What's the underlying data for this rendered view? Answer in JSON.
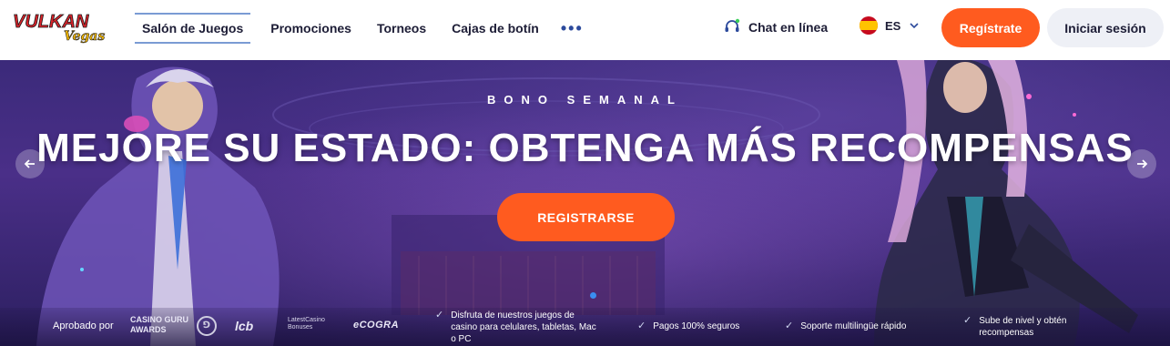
{
  "brand": {
    "logo_text_top": "VULKAN",
    "logo_text_bottom": "Vegas"
  },
  "nav": {
    "items": [
      {
        "label": "Salón de Juegos"
      },
      {
        "label": "Promociones"
      },
      {
        "label": "Torneos"
      },
      {
        "label": "Cajas de botín"
      }
    ],
    "more_label": "•••"
  },
  "header": {
    "chat_label": "Chat en línea",
    "language": "ES",
    "register_label": "Regístrate",
    "login_label": "Iniciar sesión"
  },
  "hero": {
    "kicker": "BONO SEMANAL",
    "headline": "MEJORE SU ESTADO: OBTENGA MÁS RECOMPENSAS",
    "cta_label": "REGISTRARSE"
  },
  "footer": {
    "approved_label": "Aprobado por",
    "partners": {
      "casino_guru_line1": "CASINO GURU",
      "casino_guru_line2": "AWARDS",
      "lcb": "lcb",
      "latest_line1": "LatestCasino",
      "latest_line2": "Bonuses",
      "cogra": "eCOGRA"
    },
    "features": [
      "Disfruta de nuestros juegos de casino para celulares, tabletas, Mac o PC",
      "Pagos 100% seguros",
      "Soporte multilingüe rápido",
      "Sube de nivel y obtén recompensas"
    ]
  },
  "colors": {
    "accent": "#ff5b1f",
    "nav_text": "#1d1d36",
    "active_underline": "#7a9bd4",
    "hero_bg": "#3b2a7a",
    "slider_dot": "#3a8ef0"
  }
}
